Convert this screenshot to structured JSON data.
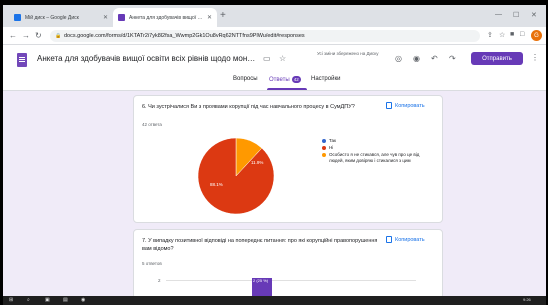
{
  "browser": {
    "tabs": [
      {
        "title": "Мій диск – Google Диск",
        "favicon_color": "#1a73e8"
      },
      {
        "title": "Анкета для здобувачів вищої о...",
        "favicon_color": "#673ab7"
      }
    ],
    "url": "docs.google.com/forms/d/1KTATr2i7yk8l2fsa_Wwmp2Gk1Ou8vRq62NTTfns9PlWu/edit#responses",
    "date_text": "06.12.2022",
    "profile_initial": "G"
  },
  "form": {
    "title": "Анкета для здобувачів вищої освіти всіх рівнів щодо моніторингу та о",
    "save_status": "Усі зміни збережено на Диску",
    "send_label": "Отправить",
    "tabs": {
      "questions": "Вопросы",
      "responses": "Ответы",
      "responses_count": "42",
      "settings": "Настройки"
    }
  },
  "cards": [
    {
      "question": "6. Чи зустрічалися Ви з проявами корупції під час навчального процесу в СумДПУ?",
      "count": "42 ответа",
      "copy_label": "Копировать",
      "slice_labels": {
        "no": "88.1%",
        "other": "11.9%"
      }
    },
    {
      "question": "7. У випадку позитивної відповіді на попереднє питання: про які корупційні правопорушення вам відомо?",
      "count": "5 ответов",
      "copy_label": "Копировать",
      "tick": "2",
      "bar_label": "2 (25 %)"
    }
  ],
  "chart_data": [
    {
      "type": "pie",
      "labels": [
        "Так",
        "Ні",
        "Особисто я не стикався, але чув про це від людей, яким довіряю і стикалися з цим"
      ],
      "values": [
        0,
        88.1,
        11.9
      ],
      "colors": [
        "#3366cc",
        "#dc3912",
        "#ff9900"
      ],
      "legend_position": "right"
    },
    {
      "type": "bar",
      "categories": [
        ""
      ],
      "values": [
        2
      ],
      "data_labels": [
        "2 (25 %)"
      ],
      "color": "#673ab7"
    }
  ],
  "taskbar": {
    "time": "9:26"
  },
  "colors": {
    "accent": "#673ab7",
    "link": "#1a73e8"
  }
}
